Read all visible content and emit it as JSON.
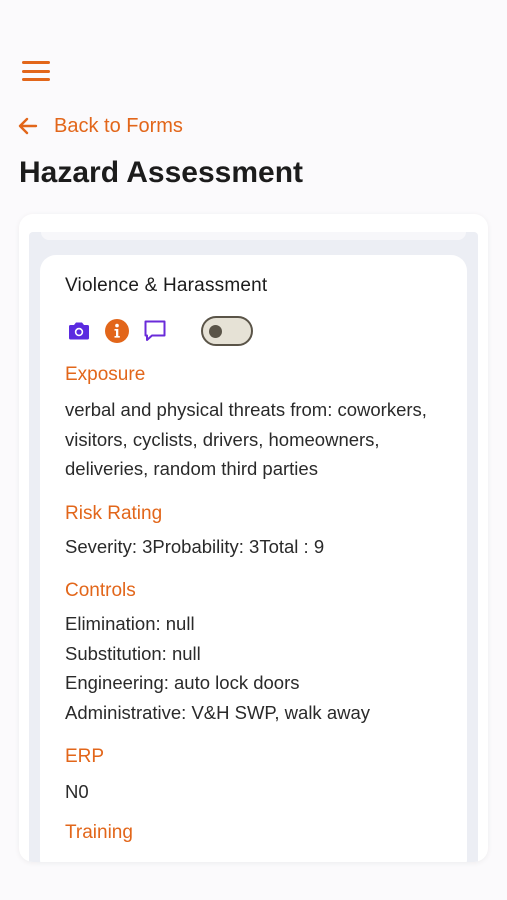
{
  "nav": {
    "menu_icon": "hamburger-menu-icon",
    "back_icon": "arrow-left-icon",
    "back_label": "Back to Forms"
  },
  "page": {
    "title": "Hazard Assessment"
  },
  "hazard": {
    "title": "Violence & Harassment",
    "icons": [
      "camera-icon",
      "info-icon",
      "comment-icon"
    ],
    "toggle_on": false,
    "sections": {
      "exposure": {
        "label": "Exposure",
        "text": "verbal and physical threats from: coworkers, visitors, cyclists, drivers, homeowners, deliveries, random third parties"
      },
      "risk_rating": {
        "label": "Risk Rating",
        "text": "Severity: 3Probability: 3Total : 9"
      },
      "controls": {
        "label": "Controls",
        "lines": [
          "Elimination: null",
          "Substitution: null",
          "Engineering: auto lock doors",
          "Administrative: V&H SWP, walk away"
        ]
      },
      "erp": {
        "label": "ERP",
        "text": "N0"
      },
      "next_label": "Training"
    }
  },
  "colors": {
    "accent": "#e2661a",
    "camera": "#5b2be0",
    "info": "#e2661a",
    "comment": "#6a2bd9",
    "toggle_off": "#5a5448"
  }
}
